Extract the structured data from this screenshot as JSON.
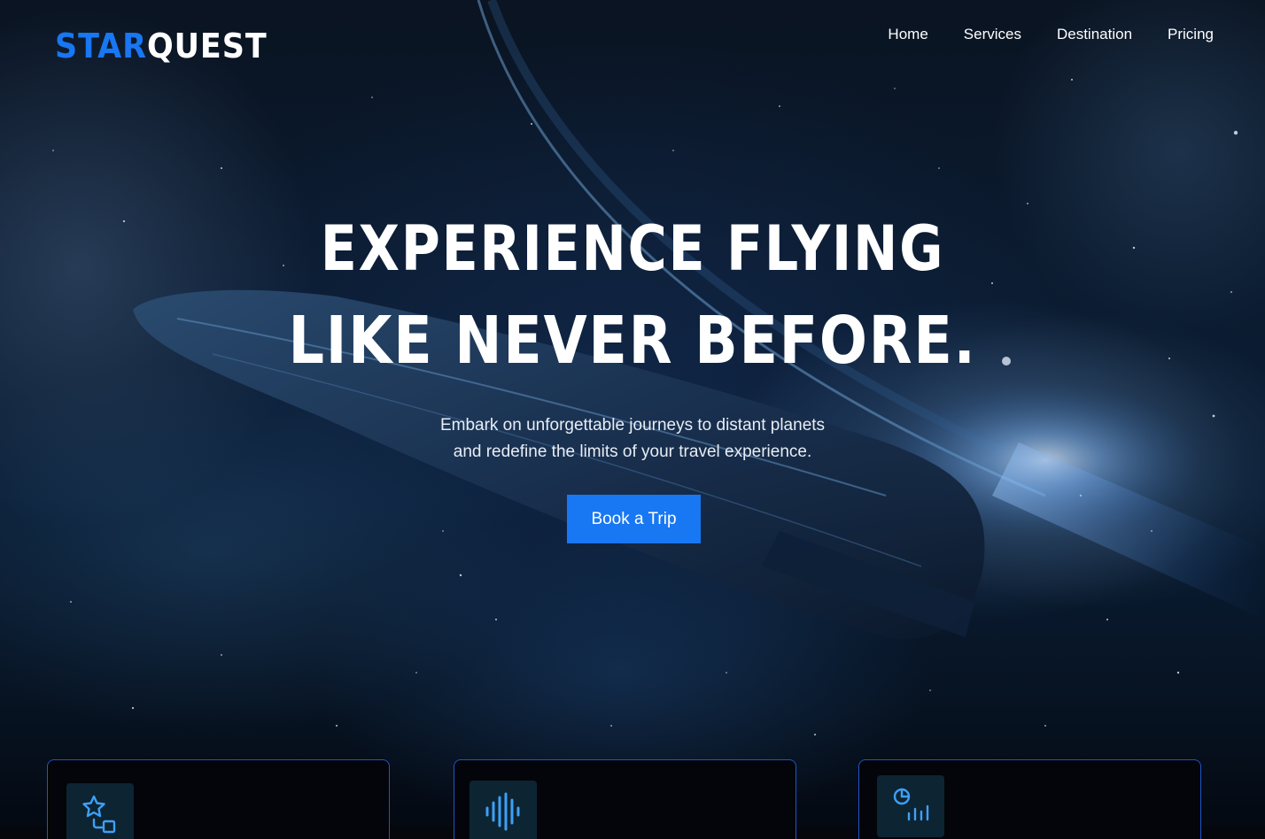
{
  "brand": {
    "part1": "STAR",
    "part2": "QUEST",
    "accent": "#1877f2"
  },
  "nav": {
    "items": [
      {
        "label": "Home"
      },
      {
        "label": "Services"
      },
      {
        "label": "Destination"
      },
      {
        "label": "Pricing"
      }
    ]
  },
  "hero": {
    "headline_line1": "EXPERIENCE FLYING",
    "headline_line2": "LIKE NEVER BEFORE.",
    "subtitle_line1": "Embark on unforgettable journeys to distant planets",
    "subtitle_line2": "and redefine the limits of your travel experience.",
    "cta_label": "Book a Trip"
  },
  "features": {
    "cards": [
      {
        "icon": "star-shapes-icon"
      },
      {
        "icon": "audio-wave-icon"
      },
      {
        "icon": "chart-analytics-icon"
      }
    ]
  }
}
